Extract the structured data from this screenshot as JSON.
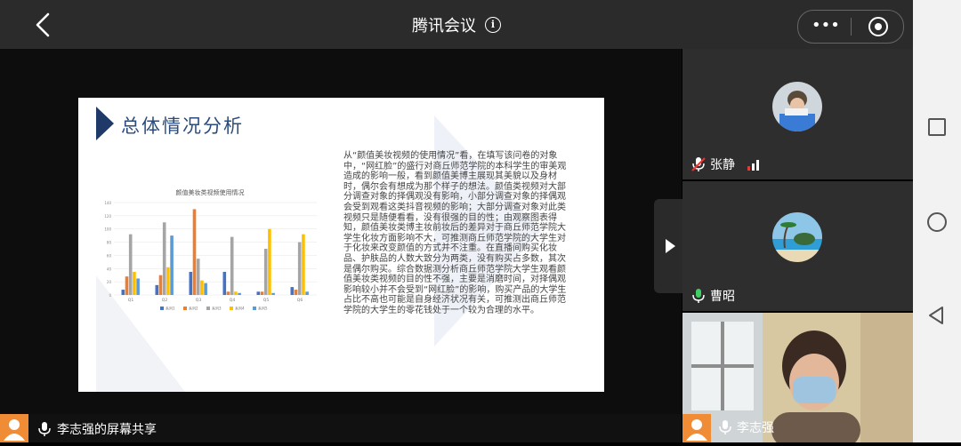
{
  "header": {
    "title": "腾讯会议"
  },
  "slide": {
    "title": "总体情况分析",
    "paragraph": "从“颜值美妆视频的使用情况”看，在填写该问卷的对象中，“网红脸”的盛行对商丘师范学院的本科学生的审美观造成的影响一般，看到颜值美博主展现其美貌以及身材时，偶尔会有想成为那个样子的想法。颜值类视频对大部分调查对象的择偶观没有影响，小部分调查对象的择偶观会受到观看这类抖音视频的影响；大部分调查对象对此类视频只是随便看看，没有很强的目的性；由观察图表得知，颜值美妆类博主妆前妆后的差异对于商丘师范学院大学生化妆方面影响不大，可推测商丘师范学院的大学生对于化妆来改变颜值的方式并不注重。在直播间购买化妆品、护肤品的人数大致分为两类，没有购买占多数，其次是偶尔购买。综合数据测分析商丘师范学院大学生观看颜值美妆类视频的目的性不强，主要是消磨时间，对择偶观影响较小并不会受到“网红脸”的影响，购买产品的大学生占比不高也可能是自身经济状况有关，可推测出商丘师范学院的大学生的零花钱处于一个较为合理的水平。"
  },
  "chart_data": {
    "type": "bar",
    "title": "颜值美妆类视频使用情况",
    "categories": [
      "Q1",
      "Q2",
      "Q3",
      "Q4",
      "Q5",
      "Q6"
    ],
    "ylim": [
      0,
      140
    ],
    "yticks": [
      0,
      20,
      40,
      60,
      80,
      100,
      120,
      140
    ],
    "series": [
      {
        "name": "系列1",
        "color": "#4472c4",
        "values": [
          8,
          15,
          35,
          35,
          5,
          12
        ]
      },
      {
        "name": "系列2",
        "color": "#ed7d31",
        "values": [
          28,
          30,
          130,
          5,
          5,
          8
        ]
      },
      {
        "name": "系列3",
        "color": "#a5a5a5",
        "values": [
          92,
          110,
          55,
          88,
          70,
          80
        ]
      },
      {
        "name": "系列4",
        "color": "#ffc000",
        "values": [
          35,
          42,
          22,
          5,
          100,
          92
        ]
      },
      {
        "name": "系列5",
        "color": "#5b9bd5",
        "values": [
          25,
          90,
          18,
          3,
          3,
          5
        ]
      }
    ]
  },
  "participants": [
    {
      "name": "张静"
    },
    {
      "name": "曹昭"
    },
    {
      "name": "李志强"
    }
  ],
  "share": {
    "label": "李志强的屏幕共享"
  }
}
